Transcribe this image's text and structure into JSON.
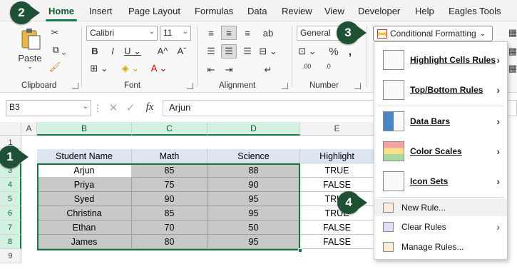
{
  "menu": {
    "tabs": [
      "Home",
      "Insert",
      "Page Layout",
      "Formulas",
      "Data",
      "Review",
      "View",
      "Developer",
      "Help",
      "Eagles Tools"
    ],
    "active": "Home"
  },
  "ribbon": {
    "clipboard": {
      "label": "Clipboard",
      "paste": "Paste"
    },
    "font": {
      "label": "Font",
      "name": "Calibri",
      "size": "11"
    },
    "alignment": {
      "label": "Alignment"
    },
    "number": {
      "label": "Number",
      "format": "General"
    },
    "conditional_formatting": "Conditional Formatting"
  },
  "formula_bar": {
    "name_box": "B3",
    "fx": "fx",
    "content": "Arjun"
  },
  "sheet": {
    "columns": [
      "A",
      "B",
      "C",
      "D",
      "E"
    ],
    "rows": [
      "1",
      "2",
      "3",
      "4",
      "5",
      "6",
      "7",
      "8",
      "9"
    ],
    "headers": [
      "Student Name",
      "Math",
      "Science",
      "Highlight"
    ],
    "data": [
      [
        "Arjun",
        "85",
        "88",
        "TRUE"
      ],
      [
        "Priya",
        "75",
        "90",
        "FALSE"
      ],
      [
        "Syed",
        "90",
        "95",
        "TRUE"
      ],
      [
        "Christina",
        "85",
        "95",
        "TRUE"
      ],
      [
        "Ethan",
        "70",
        "50",
        "FALSE"
      ],
      [
        "James",
        "80",
        "95",
        "FALSE"
      ]
    ]
  },
  "cf_menu": {
    "items": [
      {
        "label": "Highlight Cells Rules",
        "submenu": true
      },
      {
        "label": "Top/Bottom Rules",
        "submenu": true
      },
      {
        "label": "Data Bars",
        "submenu": true
      },
      {
        "label": "Color Scales",
        "submenu": true
      },
      {
        "label": "Icon Sets",
        "submenu": true
      }
    ],
    "small_items": [
      {
        "label": "New Rule...",
        "submenu": false
      },
      {
        "label": "Clear Rules",
        "submenu": true
      },
      {
        "label": "Manage Rules...",
        "submenu": false
      }
    ]
  },
  "callouts": [
    "1",
    "2",
    "3",
    "4"
  ],
  "colors": {
    "accent": "#107c41",
    "callout": "#1f5135",
    "header_fill": "#dce6f2",
    "rule_fill": "#c8c8c8"
  }
}
